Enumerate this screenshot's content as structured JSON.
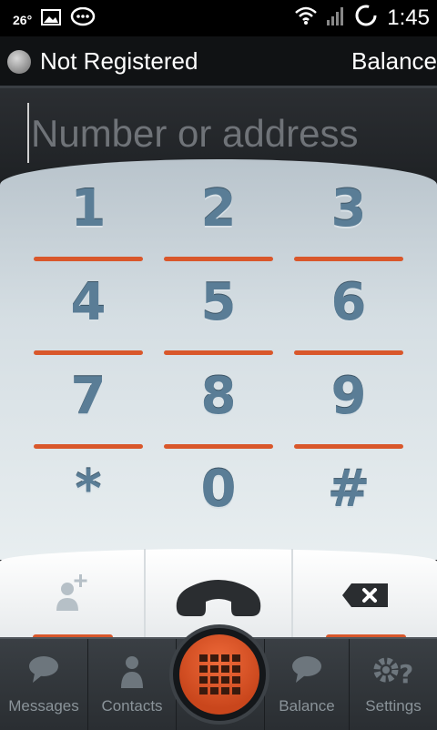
{
  "status_bar": {
    "temperature": "26°",
    "time": "1:45",
    "icons": [
      "image-icon",
      "chat-bubble-icon",
      "wifi-icon",
      "signal-icon",
      "sync-icon"
    ]
  },
  "registration": {
    "status_text": "Not Registered",
    "balance_label": "Balance"
  },
  "dial_input": {
    "placeholder": "Number or address",
    "value": ""
  },
  "keypad": {
    "keys": [
      "1",
      "2",
      "3",
      "4",
      "5",
      "6",
      "7",
      "8",
      "9",
      "*",
      "0",
      "#"
    ]
  },
  "actions": {
    "add_contact_icon": "add-contact-icon",
    "call_icon": "phone-handset-icon",
    "backspace_icon": "backspace-icon"
  },
  "tabs": {
    "messages": "Messages",
    "contacts": "Contacts",
    "dialpad_icon": "dialpad-icon",
    "balance": "Balance",
    "settings": "Settings"
  },
  "colors": {
    "accent": "#d9572b",
    "key_text": "#5a7d96",
    "tab_text": "#8a9399"
  }
}
